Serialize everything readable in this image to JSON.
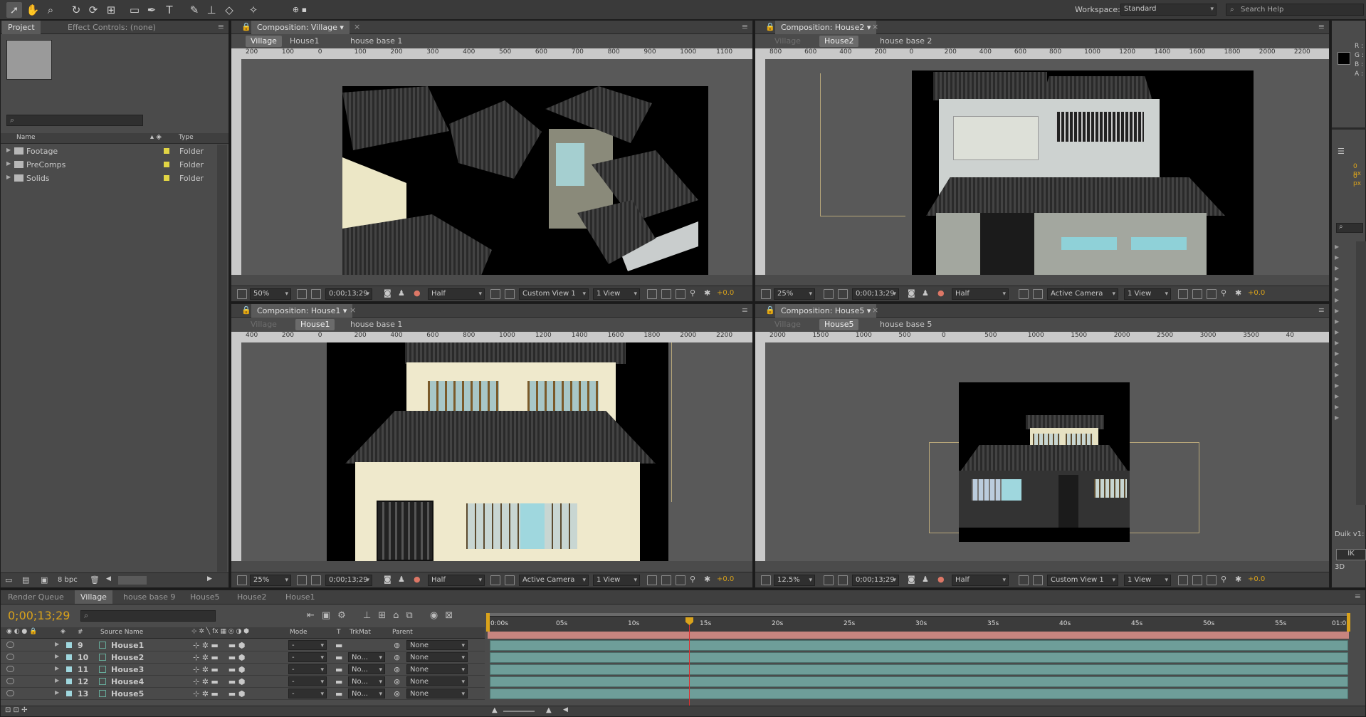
{
  "toolbar": {
    "workspace_label": "Workspace:",
    "workspace_value": "Standard",
    "search_placeholder": "Search Help",
    "tools": [
      "selection-icon",
      "hand-icon",
      "zoom-icon",
      "rotate-icon",
      "orbit-camera-icon",
      "track-xy-icon",
      "rectangle-icon",
      "pen-icon",
      "text-icon",
      "brush-icon",
      "clone-stamp-icon",
      "eraser-icon",
      "puppet-pin-icon"
    ]
  },
  "project": {
    "tabs": [
      "Project",
      "Effect Controls: (none)"
    ],
    "columns": {
      "name": "Name",
      "type": "Type"
    },
    "items": [
      {
        "name": "Footage",
        "type": "Folder"
      },
      {
        "name": "PreComps",
        "type": "Folder"
      },
      {
        "name": "Solids",
        "type": "Folder"
      }
    ],
    "bpc": "8 bpc"
  },
  "viewers": [
    {
      "title": "Composition: Village",
      "crumbs": [
        "Village",
        "House1",
        "house base 1"
      ],
      "active_crumb": 0,
      "zoom": "50%",
      "timecode": "0;00;13;29",
      "resolution": "Half",
      "view": "Custom View 1",
      "layout": "1 View",
      "exposure": "+0.0",
      "ruler": [
        "200",
        "100",
        "0",
        "100",
        "200",
        "300",
        "400",
        "500",
        "600",
        "700",
        "800",
        "900",
        "1000",
        "1100"
      ]
    },
    {
      "title": "Composition: House2",
      "crumbs": [
        "Village",
        "House2",
        "house base 2"
      ],
      "active_crumb": 1,
      "zoom": "25%",
      "timecode": "0;00;13;29",
      "resolution": "Half",
      "view": "Active Camera",
      "layout": "1 View",
      "exposure": "+0.0",
      "ruler": [
        "800",
        "600",
        "400",
        "200",
        "0",
        "200",
        "400",
        "600",
        "800",
        "1000",
        "1200",
        "1400",
        "1600",
        "1800",
        "2000",
        "2200"
      ]
    },
    {
      "title": "Composition: House1",
      "crumbs": [
        "Village",
        "House1",
        "house base 1"
      ],
      "active_crumb": 1,
      "zoom": "25%",
      "timecode": "0;00;13;29",
      "resolution": "Half",
      "view": "Active Camera",
      "layout": "1 View",
      "exposure": "+0.0",
      "ruler": [
        "400",
        "200",
        "0",
        "200",
        "400",
        "600",
        "800",
        "1000",
        "1200",
        "1400",
        "1600",
        "1800",
        "2000",
        "2200"
      ]
    },
    {
      "title": "Composition: House5",
      "crumbs": [
        "Village",
        "House5",
        "house base 5"
      ],
      "active_crumb": 1,
      "zoom": "12.5%",
      "timecode": "0;00;13;29",
      "resolution": "Half",
      "view": "Custom View 1",
      "layout": "1 View",
      "exposure": "+0.0",
      "ruler": [
        "2000",
        "1500",
        "1000",
        "500",
        "0",
        "500",
        "1000",
        "1500",
        "2000",
        "2500",
        "3000",
        "3500",
        "40"
      ]
    }
  ],
  "right_panel": {
    "info": [
      "R :",
      "G :",
      "B :",
      "A :"
    ],
    "px": [
      "0 px",
      "0 px"
    ],
    "duik": "Duik v1:",
    "ik": "IK",
    "label_3d": "3D"
  },
  "timeline": {
    "tabs": [
      "Render Queue",
      "Village",
      "house base 9",
      "House5",
      "House2",
      "House1"
    ],
    "active_tab": 1,
    "timecode": "0;00;13;29",
    "columns": {
      "source": "Source Name",
      "mode": "Mode",
      "t": "T",
      "trkmat": "TrkMat",
      "parent": "Parent"
    },
    "layers": [
      {
        "num": "9",
        "name": "House1",
        "mode": "-",
        "trkmat": "",
        "parent": "None"
      },
      {
        "num": "10",
        "name": "House2",
        "mode": "-",
        "trkmat": "No...",
        "parent": "None"
      },
      {
        "num": "11",
        "name": "House3",
        "mode": "-",
        "trkmat": "No...",
        "parent": "None"
      },
      {
        "num": "12",
        "name": "House4",
        "mode": "-",
        "trkmat": "No...",
        "parent": "None"
      },
      {
        "num": "13",
        "name": "House5",
        "mode": "-",
        "trkmat": "No...",
        "parent": "None"
      }
    ],
    "ticks": [
      "0:00s",
      "05s",
      "10s",
      "15s",
      "20s",
      "25s",
      "30s",
      "35s",
      "40s",
      "45s",
      "50s",
      "55s",
      "01:0"
    ],
    "accent": "#d9a21b",
    "track_color": "#6e9e99",
    "work_area_color": "#c7857f"
  }
}
